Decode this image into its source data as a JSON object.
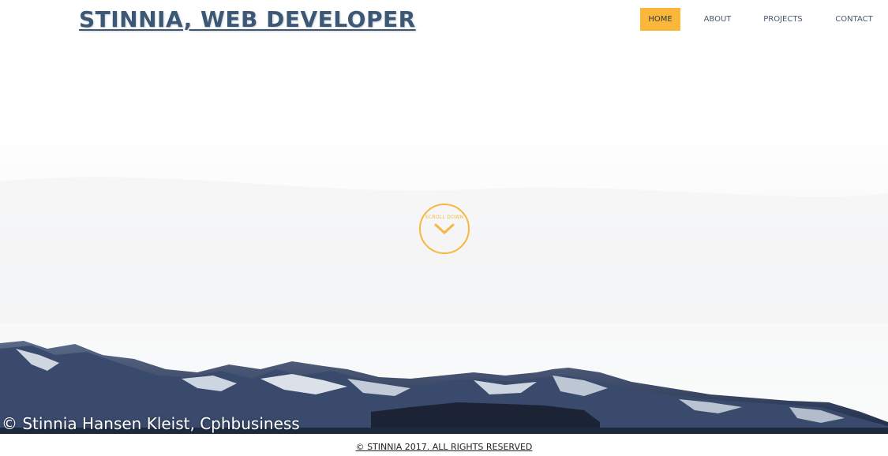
{
  "header": {
    "title": "STINNIA, WEB DEVELOPER"
  },
  "nav": {
    "items": [
      {
        "label": "HOME",
        "active": true
      },
      {
        "label": "ABOUT",
        "active": false
      },
      {
        "label": "PROJECTS",
        "active": false
      },
      {
        "label": "CONTACT",
        "active": false
      }
    ]
  },
  "hero": {
    "scroll_label": "SCROLL DOWN",
    "scroll_icon": "chevron-down-icon",
    "photo_credit": "© Stinnia Hansen Kleist, Cphbusiness"
  },
  "footer": {
    "copyright": "© STINNIA 2017. ALL RIGHTS RESERVED"
  },
  "colors": {
    "accent": "#fbb73a",
    "title": "#3b5877",
    "nav_text": "#4a5a6c"
  }
}
